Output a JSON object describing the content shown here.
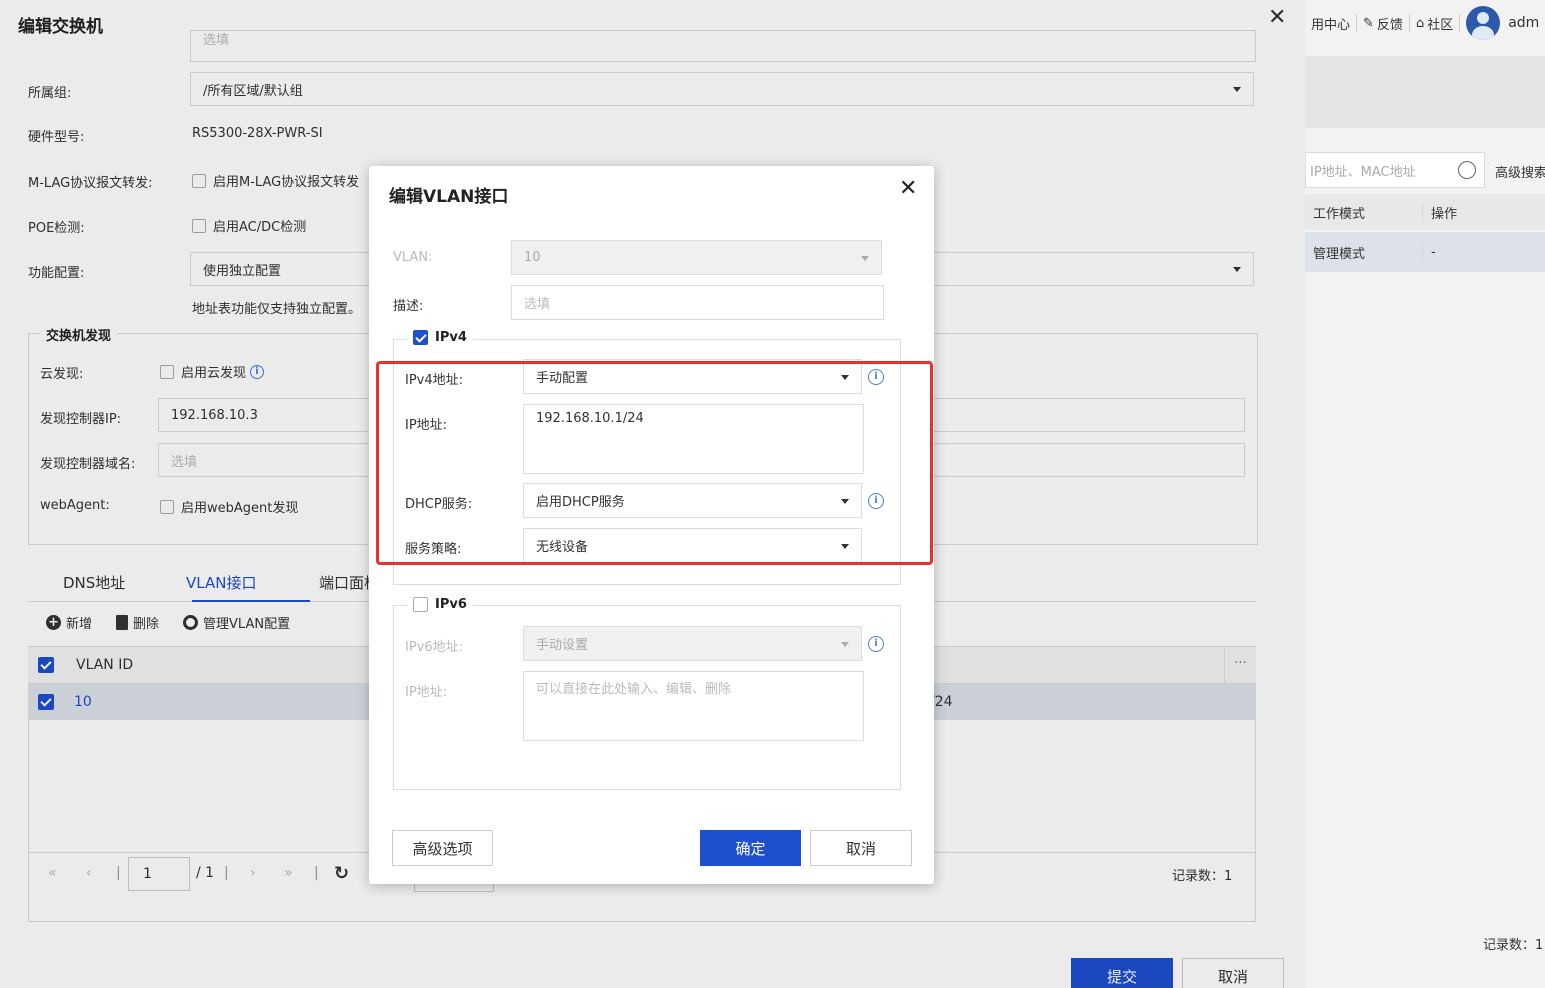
{
  "app_header": {
    "nav_app_center": "用中心",
    "nav_feedback": "反馈",
    "nav_community": "社区",
    "user_name": "adm"
  },
  "bg_panel": {
    "search_placeholder": "IP地址、MAC地址",
    "advanced_search": "高级搜索",
    "columns": [
      "工作模式",
      "操作"
    ],
    "row": [
      "管理模式",
      "-"
    ],
    "record_count": "记录数：1"
  },
  "drawer": {
    "title": "编辑交换机",
    "top_placeholder": "选填",
    "group_label": "所属组:",
    "group_value": "/所有区域/默认组",
    "model_label": "硬件型号:",
    "model_value": "RS5300-28X-PWR-SI",
    "mlag_label": "M-LAG协议报文转发:",
    "mlag_option": "启用M-LAG协议报文转发",
    "poe_label": "POE检测:",
    "poe_option": "启用AC/DC检测",
    "func_label": "功能配置:",
    "func_value": "使用独立配置",
    "func_note": "地址表功能仅支持独立配置。",
    "discovery_legend": "交换机发现",
    "cloud_label": "云发现:",
    "cloud_option": "启用云发现",
    "ctrl_ip_label": "发现控制器IP:",
    "ctrl_ip_value": "192.168.10.3",
    "ctrl_domain_label": "发现控制器域名:",
    "ctrl_domain_placeholder": "选填",
    "webagent_label": "webAgent:",
    "webagent_option": "启用webAgent发现",
    "tabs": [
      "DNS地址",
      "VLAN接口",
      "端口面板"
    ],
    "toolbar": {
      "add": "新增",
      "delete": "删除",
      "manage": "管理VLAN配置"
    },
    "table": {
      "col_vlan_id": "VLAN ID",
      "row_vlan_id": "10",
      "row_ip_tail": "/24"
    },
    "pager": {
      "first": "«",
      "prev": "‹",
      "next": "›",
      "last": "»",
      "page": "1",
      "total": "/ 1",
      "record_count": "记录数：1"
    },
    "submit": "提交",
    "cancel": "取消"
  },
  "dialog": {
    "title": "编辑VLAN接口",
    "vlan_label": "VLAN:",
    "vlan_value": "10",
    "desc_label": "描述:",
    "desc_placeholder": "选填",
    "ipv4_legend": "IPv4",
    "ipv4_mode_label": "IPv4地址:",
    "ipv4_mode_value": "手动配置",
    "ip_label": "IP地址:",
    "ip_value": "192.168.10.1/24",
    "dhcp_label": "DHCP服务:",
    "dhcp_value": "启用DHCP服务",
    "policy_label": "服务策略:",
    "policy_value": "无线设备",
    "ipv6_legend": "IPv6",
    "ipv6_mode_label": "IPv6地址:",
    "ipv6_mode_value": "手动设置",
    "ipv6_ip_label": "IP地址:",
    "ipv6_ip_placeholder": "可以直接在此处输入、编辑、删除",
    "advanced": "高级选项",
    "ok": "确定",
    "cancel": "取消"
  },
  "colors": {
    "primary": "#1e4fcf",
    "highlight": "#e8322d"
  }
}
